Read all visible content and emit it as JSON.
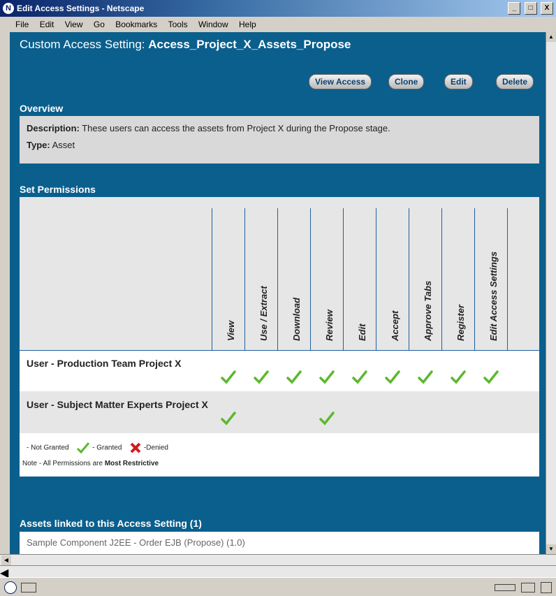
{
  "window": {
    "title": "Edit Access Settings - Netscape",
    "buttons": [
      "_",
      "□",
      "X"
    ]
  },
  "menubar": [
    "File",
    "Edit",
    "View",
    "Go",
    "Bookmarks",
    "Tools",
    "Window",
    "Help"
  ],
  "header": {
    "label": "Custom Access Setting:",
    "name": "Access_Project_X_Assets_Propose"
  },
  "actions": [
    "View Access",
    "Clone",
    "Edit",
    "Delete"
  ],
  "overview": {
    "title": "Overview",
    "description_label": "Description:",
    "description": "These users can access the assets from Project X during the Propose stage.",
    "type_label": "Type:",
    "type": "Asset"
  },
  "permissions": {
    "title": "Set Permissions",
    "columns": [
      "View",
      "Use / Extract",
      "Download",
      "Review",
      "Edit",
      "Accept",
      "Approve Tabs",
      "Register",
      "Edit Access Settings"
    ],
    "rows": [
      {
        "label": "User - Production Team Project X",
        "granted": [
          true,
          true,
          true,
          true,
          true,
          true,
          true,
          true,
          true
        ]
      },
      {
        "label": "User - Subject Matter Experts Project X",
        "granted": [
          true,
          false,
          false,
          true,
          false,
          false,
          false,
          false,
          false
        ]
      }
    ],
    "legend": {
      "not_granted": "- Not Granted",
      "granted": "- Granted",
      "denied": "-Denied",
      "note_prefix": "Note - All Permissions are ",
      "note_bold": "Most Restrictive"
    }
  },
  "assets": {
    "title": "Assets linked to this Access Setting (1)",
    "items": [
      "Sample Component J2EE - Order EJB (Propose) (1.0)"
    ]
  },
  "colors": {
    "page_blue": "#0a5f8d",
    "grid_line": "#1f5fa0",
    "check_green": "#5cb82e",
    "deny_red": "#d11a1a"
  }
}
